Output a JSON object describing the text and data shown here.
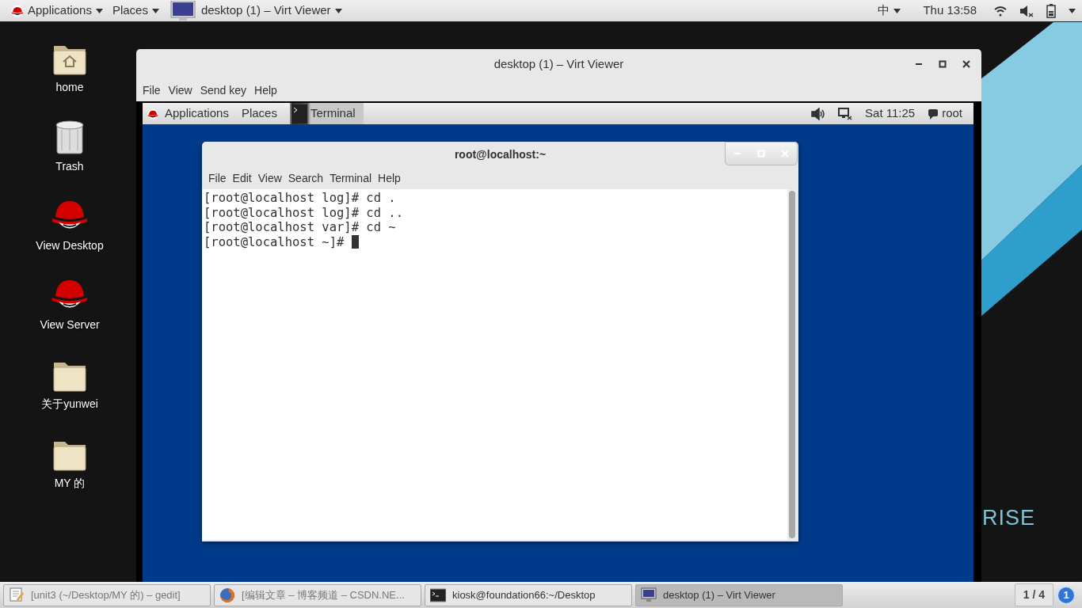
{
  "top_panel": {
    "menus": [
      {
        "label": "Applications",
        "kind": "redhat"
      },
      {
        "label": "Places",
        "kind": "plain"
      }
    ],
    "window_list": {
      "label": "desktop (1) – Virt Viewer"
    },
    "input_method": "中",
    "clock": "Thu 13:58"
  },
  "desktop_icons": [
    {
      "label": "home",
      "kind": "home"
    },
    {
      "label": "Trash",
      "kind": "trash"
    },
    {
      "label": "View Desktop",
      "kind": "redhat"
    },
    {
      "label": "View Server",
      "kind": "redhat"
    },
    {
      "label": "关于yunwei",
      "kind": "folder"
    },
    {
      "label": "MY 的",
      "kind": "folder"
    }
  ],
  "wallpaper_text": "RISE",
  "viewer": {
    "title": "desktop (1) – Virt Viewer",
    "menu": [
      "File",
      "View",
      "Send key",
      "Help"
    ],
    "guest": {
      "panel": {
        "menus": [
          "Applications",
          "Places"
        ],
        "task": "Terminal",
        "clock": "Sat 11:25",
        "user": "root"
      },
      "terminal": {
        "title": "root@localhost:~",
        "menu": [
          "File",
          "Edit",
          "View",
          "Search",
          "Terminal",
          "Help"
        ],
        "lines": [
          "[root@localhost log]# cd .",
          "[root@localhost log]# cd ..",
          "[root@localhost var]# cd ~",
          "[root@localhost ~]# "
        ],
        "cursor_visible": true
      }
    }
  },
  "taskbar": {
    "items": [
      {
        "label": "[unit3 (~/Desktop/MY 的) – gedit]",
        "kind": "gedit",
        "selected": false,
        "minimized": true
      },
      {
        "label": "[编辑文章 – 博客频道 – CSDN.NE...",
        "kind": "firefox",
        "selected": false,
        "minimized": true
      },
      {
        "label": "kiosk@foundation66:~/Desktop",
        "kind": "terminal",
        "selected": false,
        "minimized": false
      },
      {
        "label": "desktop (1) – Virt Viewer",
        "kind": "monitor",
        "selected": true,
        "minimized": false
      }
    ],
    "workspace": "1 / 4",
    "notification_count": "1"
  }
}
